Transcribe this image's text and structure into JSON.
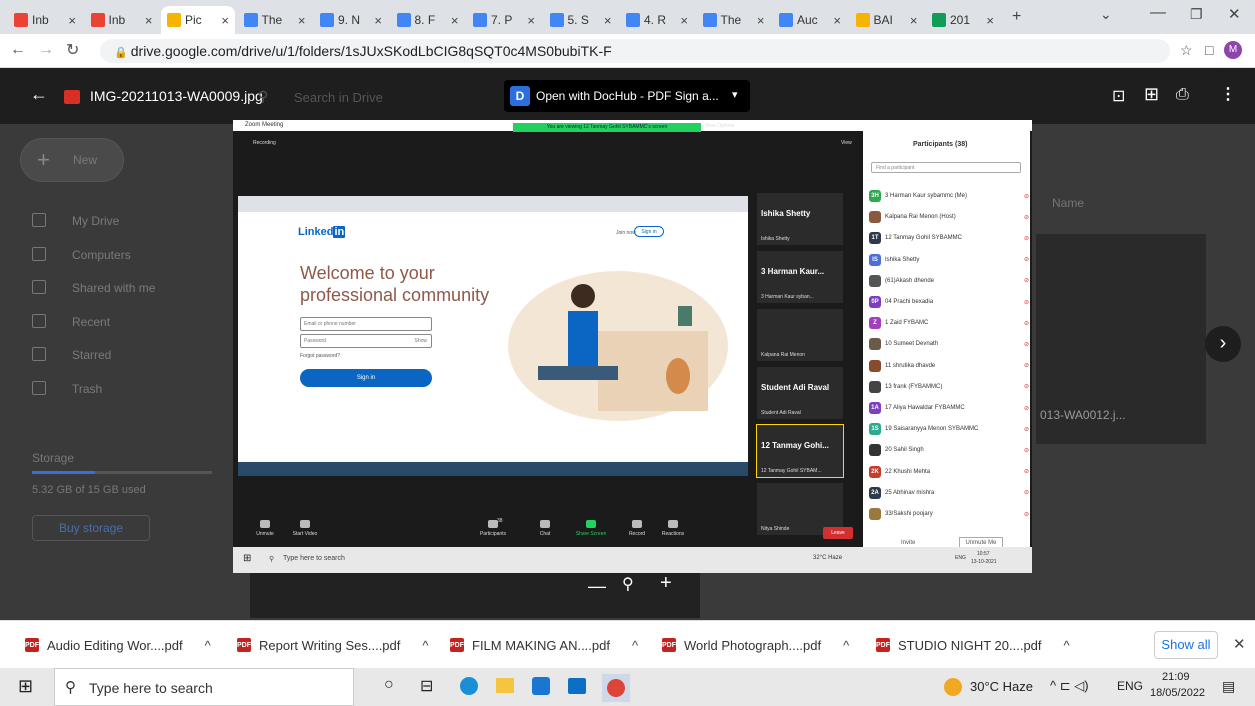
{
  "tabs": [
    {
      "label": "Inb",
      "icon": "gmail-icon"
    },
    {
      "label": "Inb",
      "icon": "gmail-icon"
    },
    {
      "label": "Pic",
      "icon": "drive-icon",
      "active": true
    },
    {
      "label": "The",
      "icon": "docs-icon"
    },
    {
      "label": "9. N",
      "icon": "docs-icon"
    },
    {
      "label": "8. F",
      "icon": "docs-icon"
    },
    {
      "label": "7. P",
      "icon": "docs-icon"
    },
    {
      "label": "5. S",
      "icon": "docs-icon"
    },
    {
      "label": "4. R",
      "icon": "docs-icon"
    },
    {
      "label": "The",
      "icon": "docs-icon"
    },
    {
      "label": "Auc",
      "icon": "docs-icon"
    },
    {
      "label": "BAI",
      "icon": "drive-icon"
    },
    {
      "label": "201",
      "icon": "sheets-icon"
    }
  ],
  "address": {
    "url": "drive.google.com/drive/u/1/folders/1sJUxSKodLbCIG8qSQT0c4MS0bubiTK-F",
    "profile": "M"
  },
  "viewer": {
    "filename": "IMG-20211013-WA0009.jpg",
    "open_with": "Open with DocHub - PDF Sign a...",
    "search_placeholder": "Search in Drive"
  },
  "drive_sidebar": {
    "new": "New",
    "items": [
      "My Drive",
      "Computers",
      "Shared with me",
      "Recent",
      "Starred",
      "Trash"
    ],
    "storage_label": "Storage",
    "storage_used": "5.32 GB of 15 GB used",
    "buy": "Buy storage",
    "name_header": "Name",
    "side_file": "013-WA0012.j..."
  },
  "zoom": {
    "title": "Zoom Meeting",
    "recording": "Recording",
    "banner": "You are viewing 12 Tanmay Gohil SYBAMMC's screen",
    "view_options": "View Options",
    "view": "View",
    "linkedin": {
      "logo": "Linked",
      "headline1": "Welcome to your",
      "headline2": "professional community",
      "email_ph": "Email or phone number",
      "password_ph": "Password",
      "show": "Show",
      "forgot": "Forgot password?",
      "sign_in": "Sign in",
      "join": "Join now",
      "sign_in_top": "Sign in"
    },
    "tiles": [
      {
        "name": "Ishika Shetty",
        "label": "Ishika Shetty"
      },
      {
        "name": "3 Harman Kaur...",
        "label": "3 Harman Kaur syban..."
      },
      {
        "name": "",
        "label": "Kalpana Rai Menon"
      },
      {
        "name": "Student Adi Raval",
        "label": "Student Adi Raval"
      },
      {
        "name": "12 Tanmay Gohi...",
        "label": "12 Tanmay Gohil SYBAM..."
      },
      {
        "name": "",
        "label": "Nitya Shinde"
      }
    ],
    "participants_title": "Participants (38)",
    "find_ph": "Find a participant",
    "participants": [
      {
        "init": "3H",
        "name": "3 Harman Kaur sybammc (Me)",
        "color": "#2da94f"
      },
      {
        "init": "",
        "name": "Kalpana Rai Menon (Host)",
        "color": "#8a5a3c"
      },
      {
        "init": "1T",
        "name": "12 Tanmay Gohil SYBAMMC",
        "color": "#2d3a4a"
      },
      {
        "init": "IS",
        "name": "Ishika Shetty",
        "color": "#4a6fd6"
      },
      {
        "init": "",
        "name": "(61)Akash dhende",
        "color": "#555"
      },
      {
        "init": "0P",
        "name": "04 Prachi bexadia",
        "color": "#7b3fbf"
      },
      {
        "init": "Z",
        "name": "1 Zaid FYBAMC",
        "color": "#a33fbf"
      },
      {
        "init": "",
        "name": "10 Sumeet Devnath",
        "color": "#6b5a4a"
      },
      {
        "init": "",
        "name": "11 shrutika dhavde",
        "color": "#8a4a2c"
      },
      {
        "init": "",
        "name": "13 frank (FYBAMMC)",
        "color": "#444"
      },
      {
        "init": "1A",
        "name": "17 Aliya Hawaldar FYBAMMC",
        "color": "#7b3fbf"
      },
      {
        "init": "1S",
        "name": "19 Saisaranyya Menon SYBAMMC",
        "color": "#2da98f"
      },
      {
        "init": "",
        "name": "20 Sahil Singh",
        "color": "#333"
      },
      {
        "init": "2K",
        "name": "22 Khushi Mehta",
        "color": "#c53c2c"
      },
      {
        "init": "2A",
        "name": "25 Abhinav mishra",
        "color": "#2d3a4a"
      },
      {
        "init": "",
        "name": "33/Sakshi poojary",
        "color": "#9a7a3c"
      }
    ],
    "invite": "Invite",
    "unmute_me": "Unmute Me",
    "controls": [
      "Unmute",
      "Start Video",
      "Participants",
      "Chat",
      "Share Screen",
      "Record",
      "Reactions"
    ],
    "participants_count": "38",
    "leave": "Leave",
    "inner_taskbar": {
      "search": "Type here to search",
      "weather": "32°C Haze",
      "lang": "ENG",
      "time": "10:57",
      "date": "13-10-2021"
    }
  },
  "downloads": [
    {
      "name": "Audio Editing Wor....pdf"
    },
    {
      "name": "Report Writing Ses....pdf"
    },
    {
      "name": "FILM MAKING AN....pdf"
    },
    {
      "name": "World Photograph....pdf"
    },
    {
      "name": "STUDIO NIGHT 20....pdf"
    }
  ],
  "show_all": "Show all",
  "taskbar": {
    "search": "Type here to search",
    "weather": "30°C Haze",
    "lang": "ENG",
    "time": "21:09",
    "date": "18/05/2022",
    "notif": "2"
  }
}
